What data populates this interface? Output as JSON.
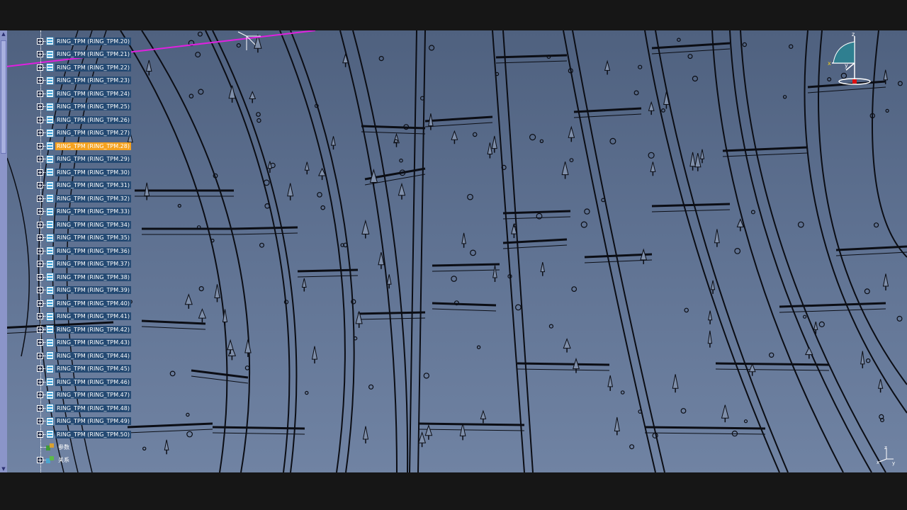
{
  "tree": {
    "items": [
      {
        "label": "RING_TPM (RING_TPM.20)",
        "selected": false
      },
      {
        "label": "RING_TPM (RING_TPM.21)",
        "selected": false
      },
      {
        "label": "RING_TPM (RING_TPM.22)",
        "selected": false
      },
      {
        "label": "RING_TPM (RING_TPM.23)",
        "selected": false
      },
      {
        "label": "RING_TPM (RING_TPM.24)",
        "selected": false
      },
      {
        "label": "RING_TPM (RING_TPM.25)",
        "selected": false
      },
      {
        "label": "RING_TPM (RING_TPM.26)",
        "selected": false
      },
      {
        "label": "RING_TPM (RING_TPM.27)",
        "selected": false
      },
      {
        "label": "RING_TPM (RING_TPM.28)",
        "selected": true
      },
      {
        "label": "RING_TPM (RING_TPM.29)",
        "selected": false
      },
      {
        "label": "RING_TPM (RING_TPM.30)",
        "selected": false
      },
      {
        "label": "RING_TPM (RING_TPM.31)",
        "selected": false
      },
      {
        "label": "RING_TPM (RING_TPM.32)",
        "selected": false
      },
      {
        "label": "RING_TPM (RING_TPM.33)",
        "selected": false
      },
      {
        "label": "RING_TPM (RING_TPM.34)",
        "selected": false
      },
      {
        "label": "RING_TPM (RING_TPM.35)",
        "selected": false
      },
      {
        "label": "RING_TPM (RING_TPM.36)",
        "selected": false
      },
      {
        "label": "RING_TPM (RING_TPM.37)",
        "selected": false
      },
      {
        "label": "RING_TPM (RING_TPM.38)",
        "selected": false
      },
      {
        "label": "RING_TPM (RING_TPM.39)",
        "selected": false
      },
      {
        "label": "RING_TPM (RING_TPM.40)",
        "selected": false
      },
      {
        "label": "RING_TPM (RING_TPM.41)",
        "selected": false
      },
      {
        "label": "RING_TPM (RING_TPM.42)",
        "selected": false
      },
      {
        "label": "RING_TPM (RING_TPM.43)",
        "selected": false
      },
      {
        "label": "RING_TPM (RING_TPM.44)",
        "selected": false
      },
      {
        "label": "RING_TPM (RING_TPM.45)",
        "selected": false
      },
      {
        "label": "RING_TPM (RING_TPM.46)",
        "selected": false
      },
      {
        "label": "RING_TPM (RING_TPM.47)",
        "selected": false
      },
      {
        "label": "RING_TPM (RING_TPM.48)",
        "selected": false
      },
      {
        "label": "RING_TPM (RING_TPM.49)",
        "selected": false
      },
      {
        "label": "RING_TPM (RING_TPM.50)",
        "selected": false
      }
    ],
    "parameters_label": "参数",
    "relations_label": "关系"
  },
  "compass": {
    "axis_x": "x",
    "axis_y": "y",
    "axis_z": "z"
  },
  "corner_axes": {
    "axis_x": "x",
    "axis_y": "y",
    "axis_z": "z"
  },
  "colors": {
    "background_top": "#4f617f",
    "background_bottom": "#7083a3",
    "wireframe": "#0b0d14",
    "selection": "#f5a21f",
    "tree_label_bg": "#254a73",
    "highlight_line": "#e020e0",
    "scrollbar": "#8b95c9"
  }
}
